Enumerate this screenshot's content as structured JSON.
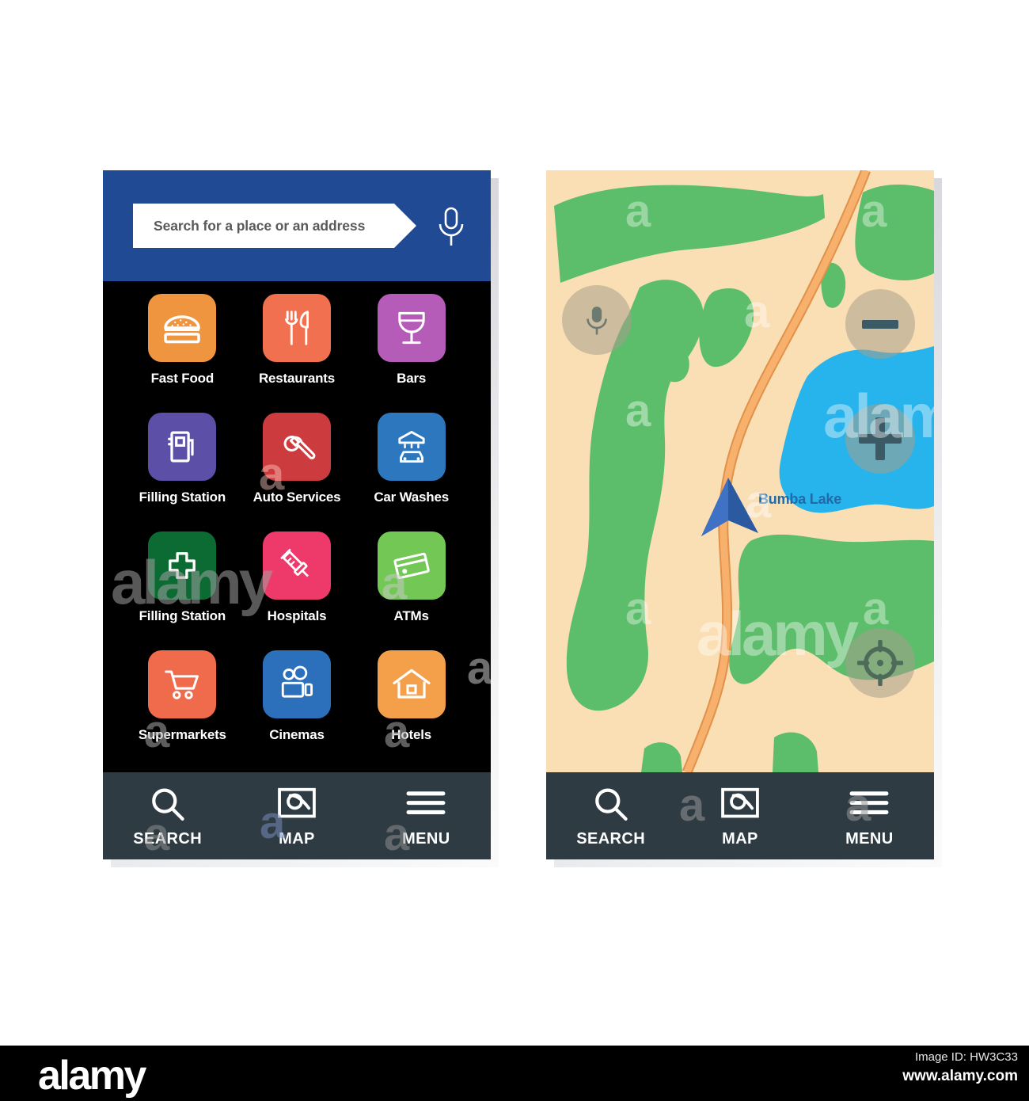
{
  "app": {
    "search": {
      "placeholder": "Search for a place or an address",
      "mic_icon": "microphone-icon"
    },
    "categories": [
      {
        "label": "Fast Food",
        "icon": "burger-icon",
        "color": "#f0953f"
      },
      {
        "label": "Restaurants",
        "icon": "fork-knife-icon",
        "color": "#f0704f"
      },
      {
        "label": "Bars",
        "icon": "wine-glass-icon",
        "color": "#b55cb8"
      },
      {
        "label": "Filling Station",
        "icon": "fuel-pump-icon",
        "color": "#5b4fa8"
      },
      {
        "label": "Auto Services",
        "icon": "wrench-icon",
        "color": "#cc3c3e"
      },
      {
        "label": "Car Washes",
        "icon": "car-wash-icon",
        "color": "#2c77bd"
      },
      {
        "label": "Filling Station",
        "icon": "medical-cross-icon",
        "color": "#0c6b33"
      },
      {
        "label": "Hospitals",
        "icon": "syringe-icon",
        "color": "#ed3a6b"
      },
      {
        "label": "ATMs",
        "icon": "credit-card-icon",
        "color": "#72c755"
      },
      {
        "label": "Supermarkets",
        "icon": "shopping-cart-icon",
        "color": "#f06a4c"
      },
      {
        "label": "Cinemas",
        "icon": "film-camera-icon",
        "color": "#2c6fba"
      },
      {
        "label": "Hotels",
        "icon": "house-icon",
        "color": "#f4a04a"
      }
    ],
    "bottom_nav": [
      {
        "label": "SEARCH",
        "icon": "magnifier-icon"
      },
      {
        "label": "MAP",
        "icon": "map-globe-icon"
      },
      {
        "label": "MENU",
        "icon": "hamburger-menu-icon"
      }
    ]
  },
  "map": {
    "lake_label": "Bumba Lake",
    "controls": {
      "mic": "microphone-icon",
      "zoom_out": "minus-icon",
      "zoom_in": "plus-icon",
      "locate": "crosshair-target-icon"
    },
    "colors": {
      "land": "#fbdfb4",
      "park": "#5cbd6a",
      "water": "#27b3ec",
      "road": "#f0a65a",
      "marker": "#2c5aa0",
      "label": "#1e6ba8"
    },
    "bottom_nav": [
      {
        "label": "SEARCH",
        "icon": "magnifier-icon"
      },
      {
        "label": "MAP",
        "icon": "map-globe-icon"
      },
      {
        "label": "MENU",
        "icon": "hamburger-menu-icon"
      }
    ]
  },
  "watermarks": {
    "brand": "alamy",
    "letter": "a"
  },
  "footer": {
    "logo": "alamy",
    "image_id": "Image ID: HW3C33",
    "website": "www.alamy.com"
  }
}
